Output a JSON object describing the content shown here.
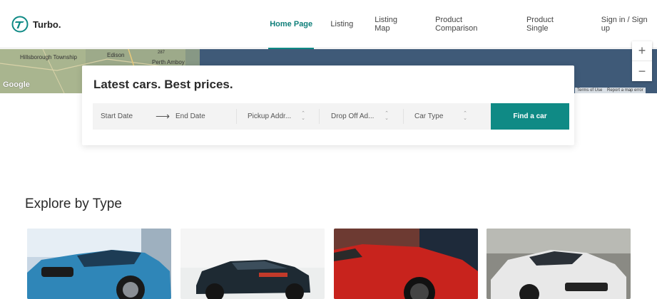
{
  "brand": {
    "name": "Turbo.",
    "accent": "#0f8a85"
  },
  "nav": {
    "items": [
      {
        "label": "Home Page",
        "active": true
      },
      {
        "label": "Listing"
      },
      {
        "label": "Listing Map"
      },
      {
        "label": "Product Comparison"
      },
      {
        "label": "Product Single"
      },
      {
        "label": "Sign in / Sign up"
      }
    ]
  },
  "map": {
    "places": [
      "Hillsborough Township",
      "Edison",
      "Perth Amboy",
      "287"
    ],
    "zoom_in": "+",
    "zoom_out": "−",
    "google": "Google",
    "terms": "Terms of Use",
    "report": "Report a map error"
  },
  "search": {
    "title": "Latest cars. Best prices.",
    "start_date": "Start Date",
    "end_date": "End Date",
    "pickup": "Pickup Addr...",
    "dropoff": "Drop Off Ad...",
    "car_type": "Car Type",
    "find_button": "Find a car"
  },
  "explore": {
    "title": "Explore by Type",
    "cars": [
      {
        "name": "blue-sedan",
        "color": "#2f86b8"
      },
      {
        "name": "black-coupe",
        "color": "#1e2a33"
      },
      {
        "name": "red-coupe",
        "color": "#c8231d"
      },
      {
        "name": "white-sports",
        "color": "#e8e8e8"
      }
    ]
  }
}
